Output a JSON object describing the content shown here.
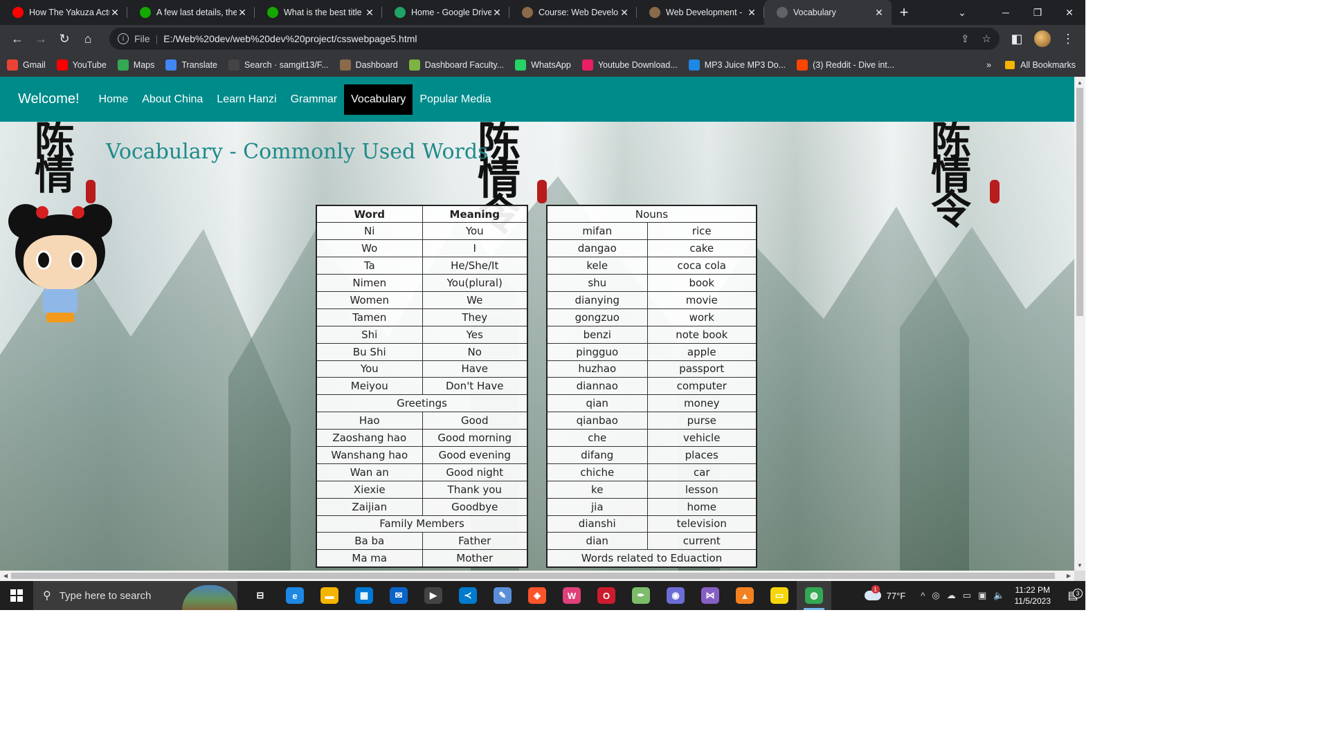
{
  "browser": {
    "tabs": [
      {
        "title": "How The Yakuza Actu",
        "icon": "youtube-icon",
        "color": "#ff0000"
      },
      {
        "title": "A few last details, the",
        "icon": "upwork-icon",
        "color": "#14a800"
      },
      {
        "title": "What is the best title",
        "icon": "upwork-icon",
        "color": "#14a800"
      },
      {
        "title": "Home - Google Drive",
        "icon": "google-drive-icon",
        "color": "#1fa463"
      },
      {
        "title": "Course: Web Develop",
        "icon": "course-icon",
        "color": "#8a6a4a"
      },
      {
        "title": "Web Development -",
        "icon": "course-icon",
        "color": "#8a6a4a"
      },
      {
        "title": "Vocabulary",
        "icon": "globe-icon",
        "color": "#5f6368"
      }
    ],
    "new_tab": "+",
    "address": {
      "scheme": "File",
      "url": "E:/Web%20dev/web%20dev%20project/csswebpage5.html"
    },
    "bookmarks": [
      {
        "label": "Gmail",
        "color": "#ea4335"
      },
      {
        "label": "YouTube",
        "color": "#ff0000"
      },
      {
        "label": "Maps",
        "color": "#34a853"
      },
      {
        "label": "Translate",
        "color": "#4285f4"
      },
      {
        "label": "Search · samgit13/F...",
        "color": "#444444"
      },
      {
        "label": "Dashboard",
        "color": "#8a6a4a"
      },
      {
        "label": "Dashboard Faculty...",
        "color": "#7cb342"
      },
      {
        "label": "WhatsApp",
        "color": "#25d366"
      },
      {
        "label": "Youtube Download...",
        "color": "#e91e63"
      },
      {
        "label": "MP3 Juice MP3 Do...",
        "color": "#1e88e5"
      },
      {
        "label": "(3) Reddit - Dive int...",
        "color": "#ff4500"
      }
    ],
    "more_bookmarks": "»",
    "all_bookmarks": "All Bookmarks"
  },
  "site": {
    "brand": "Welcome!",
    "nav": [
      "Home",
      "About China",
      "Learn Hanzi",
      "Grammar",
      "Vocabulary",
      "Popular Media"
    ],
    "active_nav": "Vocabulary",
    "heading": "Vocabulary - Commonly Used Words",
    "accent": "#008b8b"
  },
  "table1": {
    "headers": [
      "Word",
      "Meaning"
    ],
    "rows": [
      [
        "Ni",
        "You"
      ],
      [
        "Wo",
        "I"
      ],
      [
        "Ta",
        "He/She/It"
      ],
      [
        "Nimen",
        "You(plural)"
      ],
      [
        "Women",
        "We"
      ],
      [
        "Tamen",
        "They"
      ],
      [
        "Shi",
        "Yes"
      ],
      [
        "Bu Shi",
        "No"
      ],
      [
        "You",
        "Have"
      ],
      [
        "Meiyou",
        "Don't Have"
      ],
      [
        "Greetings"
      ],
      [
        "Hao",
        "Good"
      ],
      [
        "Zaoshang hao",
        "Good morning"
      ],
      [
        "Wanshang hao",
        "Good evening"
      ],
      [
        "Wan an",
        "Good night"
      ],
      [
        "Xiexie",
        "Thank you"
      ],
      [
        "Zaijian",
        "Goodbye"
      ],
      [
        "Family Members"
      ],
      [
        "Ba ba",
        "Father"
      ],
      [
        "Ma ma",
        "Mother"
      ]
    ]
  },
  "table2": {
    "rows": [
      [
        "Nouns"
      ],
      [
        "mifan",
        "rice"
      ],
      [
        "dangao",
        "cake"
      ],
      [
        "kele",
        "coca cola"
      ],
      [
        "shu",
        "book"
      ],
      [
        "dianying",
        "movie"
      ],
      [
        "gongzuo",
        "work"
      ],
      [
        "benzi",
        "note book"
      ],
      [
        "pingguo",
        "apple"
      ],
      [
        "huzhao",
        "passport"
      ],
      [
        "diannao",
        "computer"
      ],
      [
        "qian",
        "money"
      ],
      [
        "qianbao",
        "purse"
      ],
      [
        "che",
        "vehicle"
      ],
      [
        "difang",
        "places"
      ],
      [
        "chiche",
        "car"
      ],
      [
        "ke",
        "lesson"
      ],
      [
        "jia",
        "home"
      ],
      [
        "dianshi",
        "television"
      ],
      [
        "dian",
        "current"
      ],
      [
        "Words related to Eduaction"
      ]
    ]
  },
  "taskbar": {
    "search_placeholder": "Type here to search",
    "apps": [
      {
        "name": "task-view",
        "color": "#1f1f1f"
      },
      {
        "name": "edge",
        "color": "#1e88e5"
      },
      {
        "name": "file-explorer",
        "color": "#f4b400"
      },
      {
        "name": "microsoft-store",
        "color": "#0078d4"
      },
      {
        "name": "mail",
        "color": "#0a64c8"
      },
      {
        "name": "media-player",
        "color": "#444444"
      },
      {
        "name": "vs-code",
        "color": "#007acc"
      },
      {
        "name": "notepad",
        "color": "#5a8fd8"
      },
      {
        "name": "brave",
        "color": "#fb542b"
      },
      {
        "name": "wps",
        "color": "#e0407a"
      },
      {
        "name": "opera",
        "color": "#cc1b2c"
      },
      {
        "name": "notepad-plus",
        "color": "#7dbc6a"
      },
      {
        "name": "disc-app",
        "color": "#6c6cd6"
      },
      {
        "name": "visual-studio",
        "color": "#865fc5"
      },
      {
        "name": "vlc",
        "color": "#f48120"
      },
      {
        "name": "sticky-notes",
        "color": "#f6d50a"
      },
      {
        "name": "chrome",
        "color": "#34a853"
      }
    ],
    "weather": "77°F",
    "weather_badge": "1",
    "time": "11:22 PM",
    "date": "11/5/2023",
    "notifications": "3"
  }
}
